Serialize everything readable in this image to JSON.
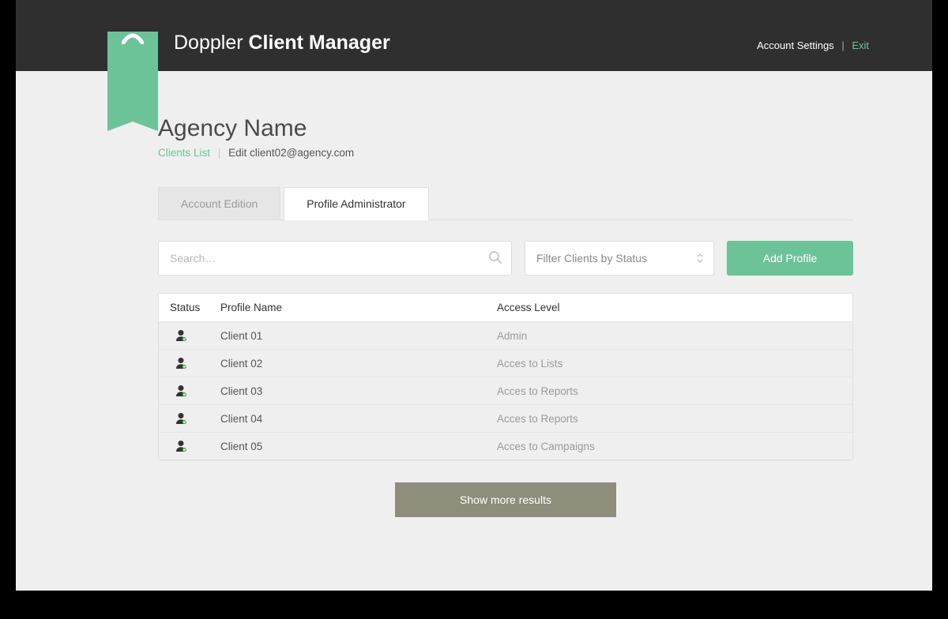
{
  "header": {
    "brand_light": "Doppler ",
    "brand_bold": "Client Manager",
    "settings_label": "Account Settings",
    "exit_label": "Exit"
  },
  "page": {
    "title": "Agency Name",
    "breadcrumb_link": "Clients List",
    "breadcrumb_current": "Edit client02@agency.com"
  },
  "tabs": {
    "account_edition": "Account Edition",
    "profile_admin": "Profile Administrator"
  },
  "controls": {
    "search_placeholder": "Search…",
    "filter_label": "Filter Clients by Status",
    "add_label": "Add Profile"
  },
  "columns": {
    "status": "Status",
    "name": "Profile Name",
    "access": "Access Level"
  },
  "rows": [
    {
      "name": "Client 01",
      "access": "Admin"
    },
    {
      "name": "Client 02",
      "access": "Acces to Lists"
    },
    {
      "name": "Client 03",
      "access": "Acces to Reports"
    },
    {
      "name": "Client 04",
      "access": "Acces to Reports"
    },
    {
      "name": "Client 05",
      "access": "Acces to Campaigns"
    }
  ],
  "more_label": "Show more results",
  "colors": {
    "accent": "#6cc398",
    "topbar": "#2f2f2f",
    "more_btn": "#8f8d7b"
  }
}
